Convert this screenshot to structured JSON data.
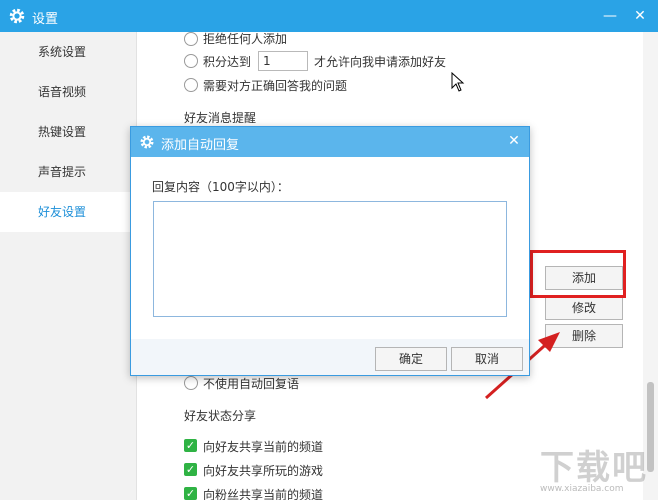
{
  "window": {
    "title": "设置",
    "minimize_glyph": "—",
    "close_glyph": "✕"
  },
  "sidebar": {
    "items": [
      {
        "label": "系统设置"
      },
      {
        "label": "语音视频"
      },
      {
        "label": "热键设置"
      },
      {
        "label": "声音提示"
      },
      {
        "label": "好友设置"
      }
    ]
  },
  "friend_add": {
    "option_reject": "拒绝任何人添加",
    "option_score_prefix": "积分达到",
    "score_value": "1",
    "option_score_suffix": "才允许向我申请添加好友",
    "option_question": "需要对方正确回答我的问题"
  },
  "friend_msg": {
    "heading": "好友消息提醒",
    "no_autoreply": "不使用自动回复语"
  },
  "side_buttons": {
    "add": "添加",
    "modify": "修改",
    "delete": "删除"
  },
  "share": {
    "heading": "好友状态分享",
    "items": [
      {
        "label": "向好友共享当前的频道"
      },
      {
        "label": "向好友共享所玩的游戏"
      },
      {
        "label": "向粉丝共享当前的频道"
      }
    ]
  },
  "dialog": {
    "title": "添加自动回复",
    "label": "回复内容（100字以内）：",
    "content": "",
    "ok": "确定",
    "cancel": "取消",
    "close_glyph": "✕"
  },
  "watermark": {
    "text": "下载吧",
    "url_text": "www.xiazaiba.com"
  },
  "colors": {
    "accent": "#2aa3e6",
    "dialog_title": "#5bb5ec",
    "highlight": "#e02020",
    "checkbox": "#2fb344"
  }
}
